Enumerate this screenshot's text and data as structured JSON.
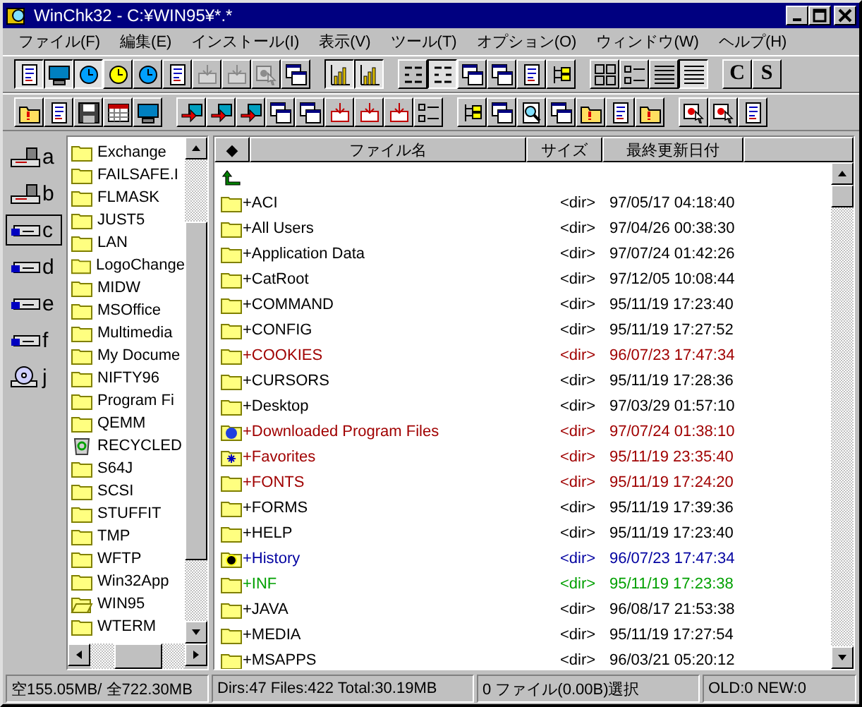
{
  "window": {
    "title": "WinChk32 - C:¥WIN95¥*.*"
  },
  "menu": [
    "ファイル(F)",
    "編集(E)",
    "インストール(I)",
    "表示(V)",
    "ツール(T)",
    "オプション(O)",
    "ウィンドウ(W)",
    "ヘルプ(H)"
  ],
  "toolbar_1": [
    [
      {
        "kind": "doc",
        "pressed": true,
        "disabled": false
      },
      {
        "kind": "monitor",
        "pressed": true,
        "disabled": false
      },
      {
        "kind": "clock",
        "pressed": true,
        "disabled": false
      },
      {
        "kind": "alarm",
        "pressed": false,
        "disabled": false
      },
      {
        "kind": "clock",
        "pressed": false,
        "disabled": false
      },
      {
        "kind": "doc",
        "pressed": false,
        "disabled": false
      },
      {
        "kind": "tray",
        "pressed": false,
        "disabled": true
      },
      {
        "kind": "tray",
        "pressed": false,
        "disabled": true
      },
      {
        "kind": "select",
        "pressed": false,
        "disabled": true
      },
      {
        "kind": "windows",
        "pressed": false,
        "disabled": false
      }
    ],
    [
      {
        "kind": "chart",
        "pressed": true,
        "disabled": false
      },
      {
        "kind": "chart",
        "pressed": true,
        "disabled": false
      }
    ],
    [
      {
        "kind": "sort",
        "pressed": false,
        "disabled": false
      },
      {
        "kind": "sort",
        "pressed": true,
        "disabled": false
      },
      {
        "kind": "windows",
        "pressed": false,
        "disabled": false
      },
      {
        "kind": "windows",
        "pressed": false,
        "disabled": false
      },
      {
        "kind": "doc",
        "pressed": false,
        "disabled": false
      },
      {
        "kind": "tree",
        "pressed": false,
        "disabled": false
      }
    ],
    [
      {
        "kind": "grid",
        "pressed": false,
        "disabled": false
      },
      {
        "kind": "list",
        "pressed": false,
        "disabled": false
      },
      {
        "kind": "details",
        "pressed": false,
        "disabled": false
      },
      {
        "kind": "details",
        "pressed": true,
        "disabled": false
      }
    ],
    [
      {
        "kind": "letter",
        "label": "C",
        "pressed": false,
        "disabled": false
      },
      {
        "kind": "letter",
        "label": "S",
        "pressed": false,
        "disabled": false
      }
    ]
  ],
  "toolbar_2": [
    [
      {
        "kind": "folder"
      },
      {
        "kind": "doc"
      },
      {
        "kind": "floppy"
      },
      {
        "kind": "calendar"
      },
      {
        "kind": "monitor"
      }
    ],
    [
      {
        "kind": "arrow"
      },
      {
        "kind": "arrow"
      },
      {
        "kind": "arrow"
      },
      {
        "kind": "windows"
      },
      {
        "kind": "windows"
      },
      {
        "kind": "tray"
      },
      {
        "kind": "tray"
      },
      {
        "kind": "tray"
      },
      {
        "kind": "list"
      }
    ],
    [
      {
        "kind": "tree"
      },
      {
        "kind": "windows"
      },
      {
        "kind": "search"
      },
      {
        "kind": "windows"
      },
      {
        "kind": "folder"
      },
      {
        "kind": "doc"
      },
      {
        "kind": "folder"
      }
    ],
    [
      {
        "kind": "select"
      },
      {
        "kind": "select"
      },
      {
        "kind": "doc"
      }
    ]
  ],
  "drives": [
    {
      "kind": "floppy",
      "letter": "a",
      "selected": false
    },
    {
      "kind": "floppy",
      "letter": "b",
      "selected": false
    },
    {
      "kind": "hdd",
      "letter": "c",
      "selected": true
    },
    {
      "kind": "hdd",
      "letter": "d",
      "selected": false
    },
    {
      "kind": "hdd",
      "letter": "e",
      "selected": false
    },
    {
      "kind": "hdd",
      "letter": "f",
      "selected": false
    },
    {
      "kind": "cd",
      "letter": "j",
      "selected": false
    }
  ],
  "folders": [
    {
      "kind": "folder",
      "name": "Exchange"
    },
    {
      "kind": "folder",
      "name": "FAILSAFE.I"
    },
    {
      "kind": "folder",
      "name": "FLMASK"
    },
    {
      "kind": "folder",
      "name": "JUST5"
    },
    {
      "kind": "folder",
      "name": "LAN"
    },
    {
      "kind": "folder",
      "name": "LogoChange"
    },
    {
      "kind": "folder",
      "name": "MIDW"
    },
    {
      "kind": "folder",
      "name": "MSOffice"
    },
    {
      "kind": "folder",
      "name": "Multimedia"
    },
    {
      "kind": "folder",
      "name": "My Docume"
    },
    {
      "kind": "folder",
      "name": "NIFTY96"
    },
    {
      "kind": "folder",
      "name": "Program Fi"
    },
    {
      "kind": "folder",
      "name": "QEMM"
    },
    {
      "kind": "recycle",
      "name": "RECYCLED"
    },
    {
      "kind": "folder",
      "name": "S64J"
    },
    {
      "kind": "folder",
      "name": "SCSI"
    },
    {
      "kind": "folder",
      "name": "STUFFIT"
    },
    {
      "kind": "folder",
      "name": "TMP"
    },
    {
      "kind": "folder",
      "name": "WFTP"
    },
    {
      "kind": "folder",
      "name": "Win32App"
    },
    {
      "kind": "open",
      "name": "WIN95"
    },
    {
      "kind": "folder",
      "name": "WTERM"
    }
  ],
  "file_list": {
    "columns": [
      "◆",
      "ファイル名",
      "サイズ",
      "最終更新日付"
    ],
    "rows": [
      {
        "kind": "up"
      },
      {
        "kind": "folder",
        "name": "+ACI",
        "size": "<dir>",
        "date": "97/05/17 04:18:40",
        "color": "#000000"
      },
      {
        "kind": "folder",
        "name": "+All Users",
        "size": "<dir>",
        "date": "97/04/26 00:38:30",
        "color": "#000000"
      },
      {
        "kind": "folder",
        "name": "+Application Data",
        "size": "<dir>",
        "date": "97/07/24 01:42:26",
        "color": "#000000"
      },
      {
        "kind": "folder",
        "name": "+CatRoot",
        "size": "<dir>",
        "date": "97/12/05 10:08:44",
        "color": "#000000"
      },
      {
        "kind": "folder",
        "name": "+COMMAND",
        "size": "<dir>",
        "date": "95/11/19 17:23:40",
        "color": "#000000"
      },
      {
        "kind": "folder",
        "name": "+CONFIG",
        "size": "<dir>",
        "date": "95/11/19 17:27:52",
        "color": "#000000"
      },
      {
        "kind": "folder",
        "name": "+COOKIES",
        "size": "<dir>",
        "date": "96/07/23 17:47:34",
        "color": "#a00000"
      },
      {
        "kind": "folder",
        "name": "+CURSORS",
        "size": "<dir>",
        "date": "95/11/19 17:28:36",
        "color": "#000000"
      },
      {
        "kind": "folder",
        "name": "+Desktop",
        "size": "<dir>",
        "date": "97/03/29 01:57:10",
        "color": "#000000"
      },
      {
        "kind": "web",
        "name": "+Downloaded Program Files",
        "size": "<dir>",
        "date": "97/07/24 01:38:10",
        "color": "#a00000"
      },
      {
        "kind": "star",
        "name": "+Favorites",
        "size": "<dir>",
        "date": "95/11/19 23:35:40",
        "color": "#a00000"
      },
      {
        "kind": "folder",
        "name": "+FONTS",
        "size": "<dir>",
        "date": "95/11/19 17:24:20",
        "color": "#a00000"
      },
      {
        "kind": "folder",
        "name": "+FORMS",
        "size": "<dir>",
        "date": "95/11/19 17:39:36",
        "color": "#000000"
      },
      {
        "kind": "folder",
        "name": "+HELP",
        "size": "<dir>",
        "date": "95/11/19 17:23:40",
        "color": "#000000"
      },
      {
        "kind": "history",
        "name": "+History",
        "size": "<dir>",
        "date": "96/07/23 17:47:34",
        "color": "#0000a0"
      },
      {
        "kind": "folder",
        "name": "+INF",
        "size": "<dir>",
        "date": "95/11/19 17:23:38",
        "color": "#00a000"
      },
      {
        "kind": "folder",
        "name": "+JAVA",
        "size": "<dir>",
        "date": "96/08/17 21:53:38",
        "color": "#000000"
      },
      {
        "kind": "folder",
        "name": "+MEDIA",
        "size": "<dir>",
        "date": "95/11/19 17:27:54",
        "color": "#000000"
      },
      {
        "kind": "folder",
        "name": "+MSAPPS",
        "size": "<dir>",
        "date": "96/03/21 05:20:12",
        "color": "#000000"
      }
    ]
  },
  "status_bar": [
    "空155.05MB/ 全722.30MB",
    "Dirs:47 Files:422 Total:30.19MB",
    "0 ファイル(0.00B)選択",
    "OLD:0 NEW:0"
  ]
}
